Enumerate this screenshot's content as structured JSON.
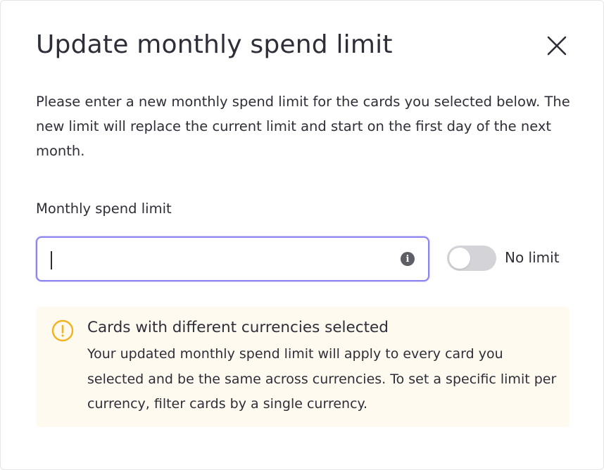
{
  "modal": {
    "title": "Update monthly spend limit",
    "description": "Please enter a new monthly spend limit for the cards you selected below. The new limit will replace the current limit and start on the first day of the next month."
  },
  "form": {
    "field_label": "Monthly spend limit",
    "input_value": "",
    "input_placeholder": "",
    "info_glyph": "i",
    "toggle_label": "No limit",
    "toggle_on": false
  },
  "alert": {
    "title": "Cards with different currencies selected",
    "body": "Your updated monthly spend limit will apply to every card you selected and be the same across currencies. To set a specific limit per currency, filter cards by a single currency."
  },
  "icons": {
    "close": "close-icon",
    "info": "info-icon",
    "warning": "warning-circle-icon"
  },
  "colors": {
    "focus_border": "#8c84f0",
    "warning_icon": "#f3b21f",
    "alert_background": "#fffaf0",
    "toggle_off": "#d3d3d8"
  }
}
